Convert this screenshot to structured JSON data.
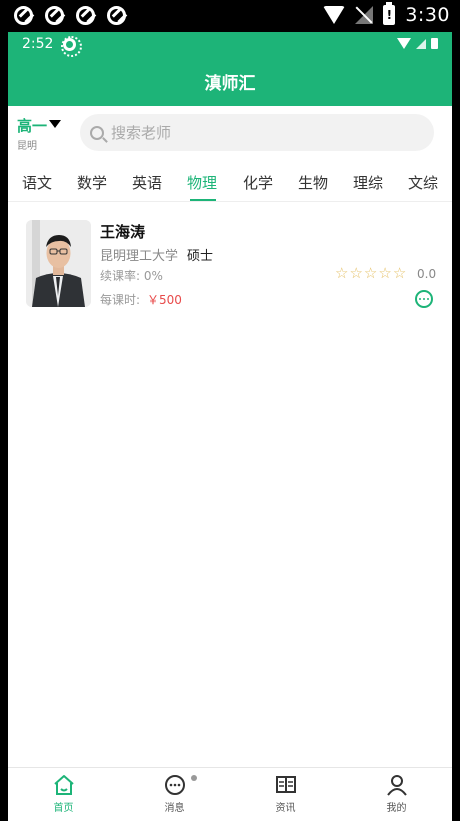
{
  "system_status": {
    "time": "3:30",
    "battery_mark": "!"
  },
  "inner_status": {
    "time": "2:52"
  },
  "header": {
    "title": "滇师汇"
  },
  "search": {
    "grade_label": "高一",
    "city": "昆明",
    "placeholder": "搜索老师"
  },
  "tabs": [
    {
      "label": "语文"
    },
    {
      "label": "数学"
    },
    {
      "label": "英语"
    },
    {
      "label": "物理"
    },
    {
      "label": "化学"
    },
    {
      "label": "生物"
    },
    {
      "label": "理综"
    },
    {
      "label": "文综"
    }
  ],
  "active_tab": "物理",
  "teacher": {
    "name": "王海涛",
    "school": "昆明理工大学",
    "degree": "硕士",
    "renew_rate_label": "续课率: 0%",
    "price_label": "每课时:",
    "price": "￥500",
    "rating": "0.0",
    "stars_total": 5,
    "stars_filled": 0
  },
  "bottom_nav": [
    {
      "label": "首页",
      "icon": "home-icon"
    },
    {
      "label": "消息",
      "icon": "message-icon"
    },
    {
      "label": "资讯",
      "icon": "book-icon"
    },
    {
      "label": "我的",
      "icon": "person-icon"
    }
  ],
  "colors": {
    "brand": "#1db478",
    "price": "#e84b4b",
    "star": "#e6c26a"
  }
}
